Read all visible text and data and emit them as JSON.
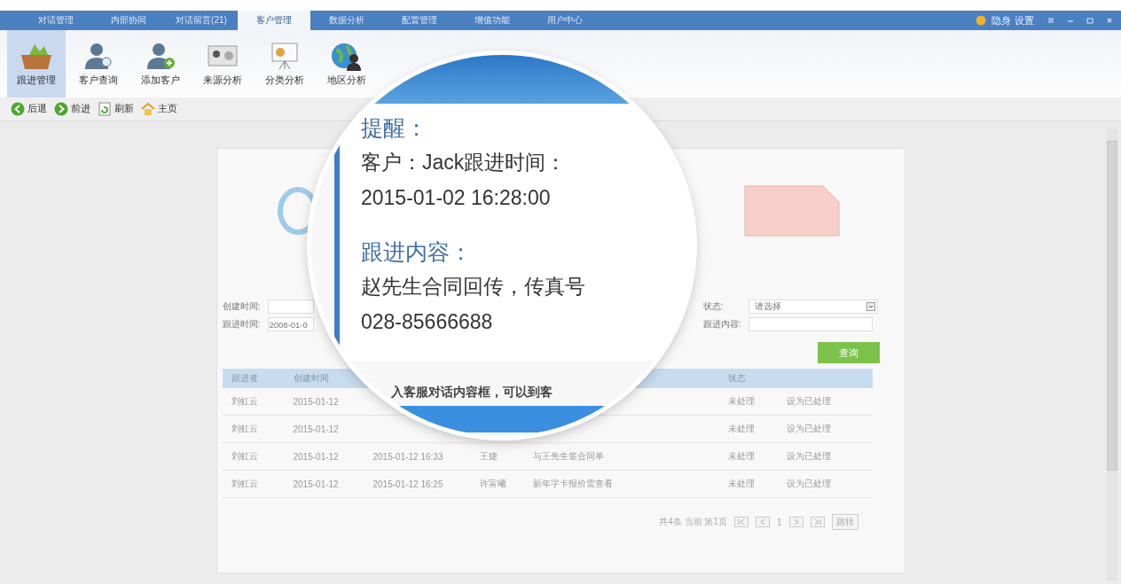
{
  "menu_tabs": [
    {
      "label": "对话管理",
      "selected": false
    },
    {
      "label": "内部协同",
      "selected": false
    },
    {
      "label": "对话留言(21)",
      "selected": false
    },
    {
      "label": "客户管理",
      "selected": true
    },
    {
      "label": "数据分析",
      "selected": false
    },
    {
      "label": "配置管理",
      "selected": false
    },
    {
      "label": "增值功能",
      "selected": false
    },
    {
      "label": "用户中心",
      "selected": false
    }
  ],
  "top_right": {
    "status": "隐身",
    "settings": "设置"
  },
  "toolbar": [
    {
      "label": "跟进管理",
      "kind": "followup",
      "selected": true
    },
    {
      "label": "客户查询",
      "kind": "person-search",
      "selected": false
    },
    {
      "label": "添加客户",
      "kind": "person-add",
      "selected": false
    },
    {
      "label": "来源分析",
      "kind": "card",
      "selected": false
    },
    {
      "label": "分类分析",
      "kind": "chart",
      "selected": false
    },
    {
      "label": "地区分析",
      "kind": "globe",
      "selected": false
    }
  ],
  "nav": [
    {
      "label": "后退",
      "kind": "back"
    },
    {
      "label": "前进",
      "kind": "forward"
    },
    {
      "label": "刷新",
      "kind": "refresh"
    },
    {
      "label": "主页",
      "kind": "home"
    }
  ],
  "filters": {
    "created_label": "创建时间:",
    "followup_label": "跟进时间:",
    "followup_value": "2008-01-0",
    "status_label": "状态:",
    "status_value": "请选择",
    "content_label": "跟进内容:",
    "query_button": "查询"
  },
  "table": {
    "columns": [
      "跟进者",
      "创建时间",
      "状态"
    ],
    "rows": [
      {
        "follower": "刘虹云",
        "created": "2015-01-12",
        "status": "未处理",
        "action": "设为已处理"
      },
      {
        "follower": "刘虹云",
        "created": "2015-01-12",
        "status": "未处理",
        "action": "设为已处理"
      },
      {
        "follower": "刘虹云",
        "created": "2015-01-12",
        "follow_time": "2015-01-12 16:33",
        "owner": "王婕",
        "content": "与王先生签合同单",
        "status": "未处理",
        "action": "设为已处理"
      },
      {
        "follower": "刘虹云",
        "created": "2015-01-12",
        "follow_time": "2015-01-12 16:25",
        "owner": "许富曦",
        "content": "新年字卡报价需查看",
        "status": "未处理",
        "action": "设为已处理"
      }
    ]
  },
  "pagination": {
    "summary": "共4条 当前 第1页",
    "page": "1",
    "go": "跳转"
  },
  "magnifier": {
    "title": "提醒：",
    "customer_line": "客户：Jack跟进时间：",
    "time": "2015-01-02 16:28:00",
    "content_label": "跟进内容：",
    "content_lines": [
      "赵先生合同回传，传真号",
      "028-85666688"
    ],
    "lower_text": "入客服对话内容框，可以到客"
  }
}
